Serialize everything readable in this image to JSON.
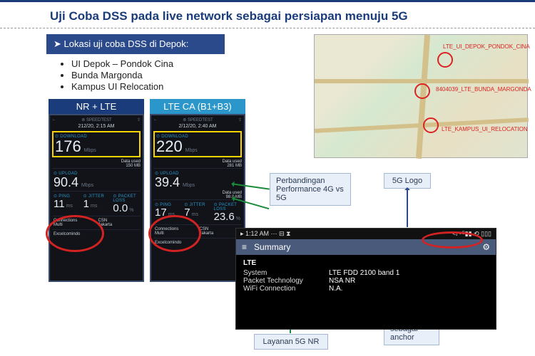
{
  "title": "Uji Coba DSS pada live network sebagai persiapan menuju 5G",
  "locations_header": "➤ Lokasi uji coba DSS di Depok:",
  "locations": [
    "UI Depok – Pondok Cina",
    "Bunda Margonda",
    "Kampus UI Relocation"
  ],
  "phone1": {
    "header": "NR + LTE",
    "time": "212/20, 2:15 AM",
    "speedtest": "⊚ SPEEDTEST",
    "download_label": "⊙ DOWNLOAD",
    "download": "176",
    "download_unit": "Mbps",
    "data_used": "Data used\n150 MB",
    "upload_label": "⊙ UPLOAD",
    "upload": "90.4",
    "upload_unit": "Mbps",
    "ping_label": "⊙ PING",
    "ping": "11",
    "jitter_label": "⊙ JITTER",
    "jitter": "1",
    "loss_label": "⊙ PACKET LOSS",
    "loss": "0.0",
    "ms": "ms",
    "pct": "%",
    "conn": "Connections\nMulti",
    "csn": "CSN\nJakarta",
    "op": "Excelcomindo"
  },
  "phone2": {
    "header": "LTE CA (B1+B3)",
    "time": "2/12/20, 2:40 AM",
    "download": "220",
    "download_unit": "Mbps",
    "data_used": "Data used\n281 MB",
    "upload": "39.4",
    "upload_data": "Data used\n98.0 MB",
    "ping": "17",
    "jitter": "7",
    "loss": "23.6",
    "conn": "Connections\nMulti",
    "csn": "CSN\nJakarta",
    "op": "Excelcomindo"
  },
  "map_labels": {
    "l1": "LTE_UI_DEPOK_PONDOK_CINA",
    "l2": "8404039_LTE_BUNDA_MARGONDA",
    "l3": "LTE_KAMPUS_UI_RELOCATION"
  },
  "annot": {
    "perf": "Perbandingan Performance 4G vs 5G",
    "logo": "5G Logo",
    "layanan": "Layanan 5G NR",
    "band": "LTE Band sebagai anchor"
  },
  "summary": {
    "time": "▸ 1:12 AM ⋯ ⊟ ⧗",
    "icons": "◅ ⁵ᴳ▮▮ ⟲ ▯▯▯",
    "menu": "≡",
    "title": "Summary",
    "gear": "⚙",
    "lte": "LTE",
    "r1k": "System",
    "r1v": "LTE FDD 2100 band 1",
    "r2k": "Packet Technology",
    "r2v": "NSA NR",
    "r3k": "WiFi Connection",
    "r3v": "N.A."
  }
}
